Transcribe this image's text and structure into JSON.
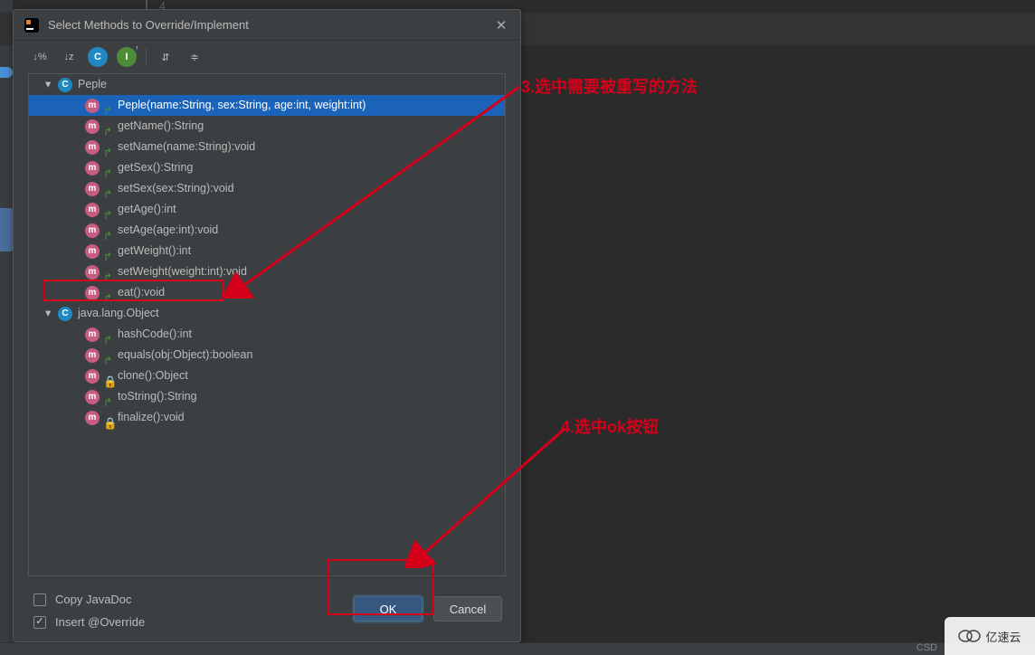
{
  "gutter": {
    "line_number": "4"
  },
  "dialog": {
    "title": "Select Methods to Override/Implement",
    "toolbar": {
      "sort_alpha": "↓%",
      "sort_vis": "↓z",
      "class_btn": "C",
      "iface_btn": "I",
      "expand": "⇵",
      "collapse": "≑"
    },
    "classes": [
      {
        "name": "Peple",
        "methods": [
          {
            "sig": "Peple(name:String, sex:String, age:int, weight:int)",
            "selected": true,
            "vis": "override"
          },
          {
            "sig": "getName():String",
            "vis": "override"
          },
          {
            "sig": "setName(name:String):void",
            "vis": "override"
          },
          {
            "sig": "getSex():String",
            "vis": "override"
          },
          {
            "sig": "setSex(sex:String):void",
            "vis": "override"
          },
          {
            "sig": "getAge():int",
            "vis": "override"
          },
          {
            "sig": "setAge(age:int):void",
            "vis": "override"
          },
          {
            "sig": "getWeight():int",
            "vis": "override"
          },
          {
            "sig": "setWeight(weight:int):void",
            "vis": "override"
          },
          {
            "sig": "eat():void",
            "vis": "override"
          }
        ]
      },
      {
        "name": "java.lang.Object",
        "methods": [
          {
            "sig": "hashCode():int",
            "vis": "override"
          },
          {
            "sig": "equals(obj:Object):boolean",
            "vis": "override"
          },
          {
            "sig": "clone():Object",
            "vis": "lock"
          },
          {
            "sig": "toString():String",
            "vis": "override"
          },
          {
            "sig": "finalize():void",
            "vis": "lock"
          }
        ]
      }
    ],
    "copy_javadoc": {
      "label": "Copy JavaDoc",
      "checked": false
    },
    "insert_override": {
      "label": "Insert @Override",
      "checked": true
    },
    "ok": "OK",
    "cancel": "Cancel"
  },
  "annotations": {
    "a3": "3.选中需要被重写的方法",
    "a4": "4.选中ok按钮"
  },
  "status": {
    "right": "CSD"
  },
  "watermark": "亿速云"
}
